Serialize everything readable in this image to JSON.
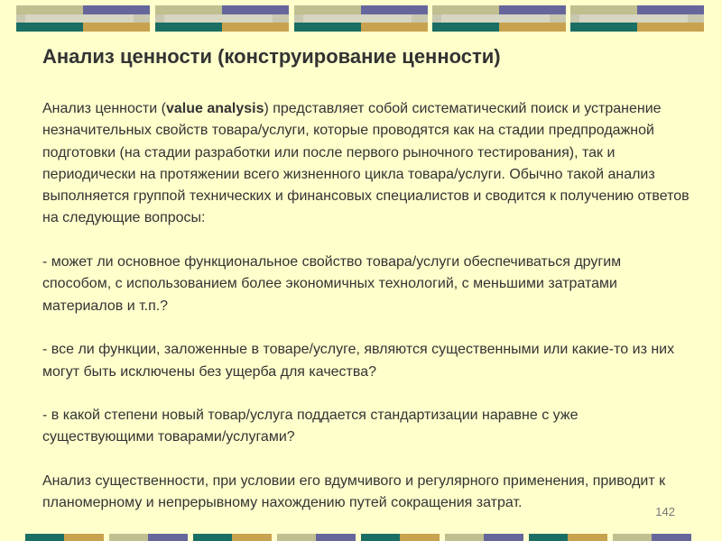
{
  "slide": {
    "title": "Анализ ценности (конструирование ценности)",
    "intro": {
      "before": "Анализ ценности (",
      "term": "value analysis",
      "after": ") представляет собой систематический поиск и устранение незначительных свойств товара/услуги, которые проводятся как на стадии предпродажной подготовки (на стадии разработки или после первого рыночного тестирования), так и периодически на протяжении всего жизненного цикла товара/услуги. Обычно такой анализ выполняется группой технических и финансовых специалистов и сводится к получению ответов на следующие вопросы:"
    },
    "questions": [
      "- может ли основное функциональное свойство товара/услуги обеспечиваться другим способом, с использованием более экономичных технологий, с меньшими затратами материалов и т.п.?",
      "- все ли функции, заложенные в товаре/услуге, являются существенными или какие-то из них могут быть исключены без ущерба для качества?",
      "- в какой степени новый товар/услуга поддается стандартизации наравне с уже существующими товарами/услугами?"
    ],
    "conclusion": "Анализ существенности, при условии его вдумчивого и регулярного применения, приводит к планомерному и непрерывному нахождению путей сокращения затрат.",
    "page_number": "142"
  },
  "colors": {
    "background": "#FFFFCC",
    "text": "#333333",
    "olive": "#BFBF8F",
    "slate_blue": "#66669C",
    "teal": "#1A6E63",
    "gold": "#C8A24E"
  }
}
